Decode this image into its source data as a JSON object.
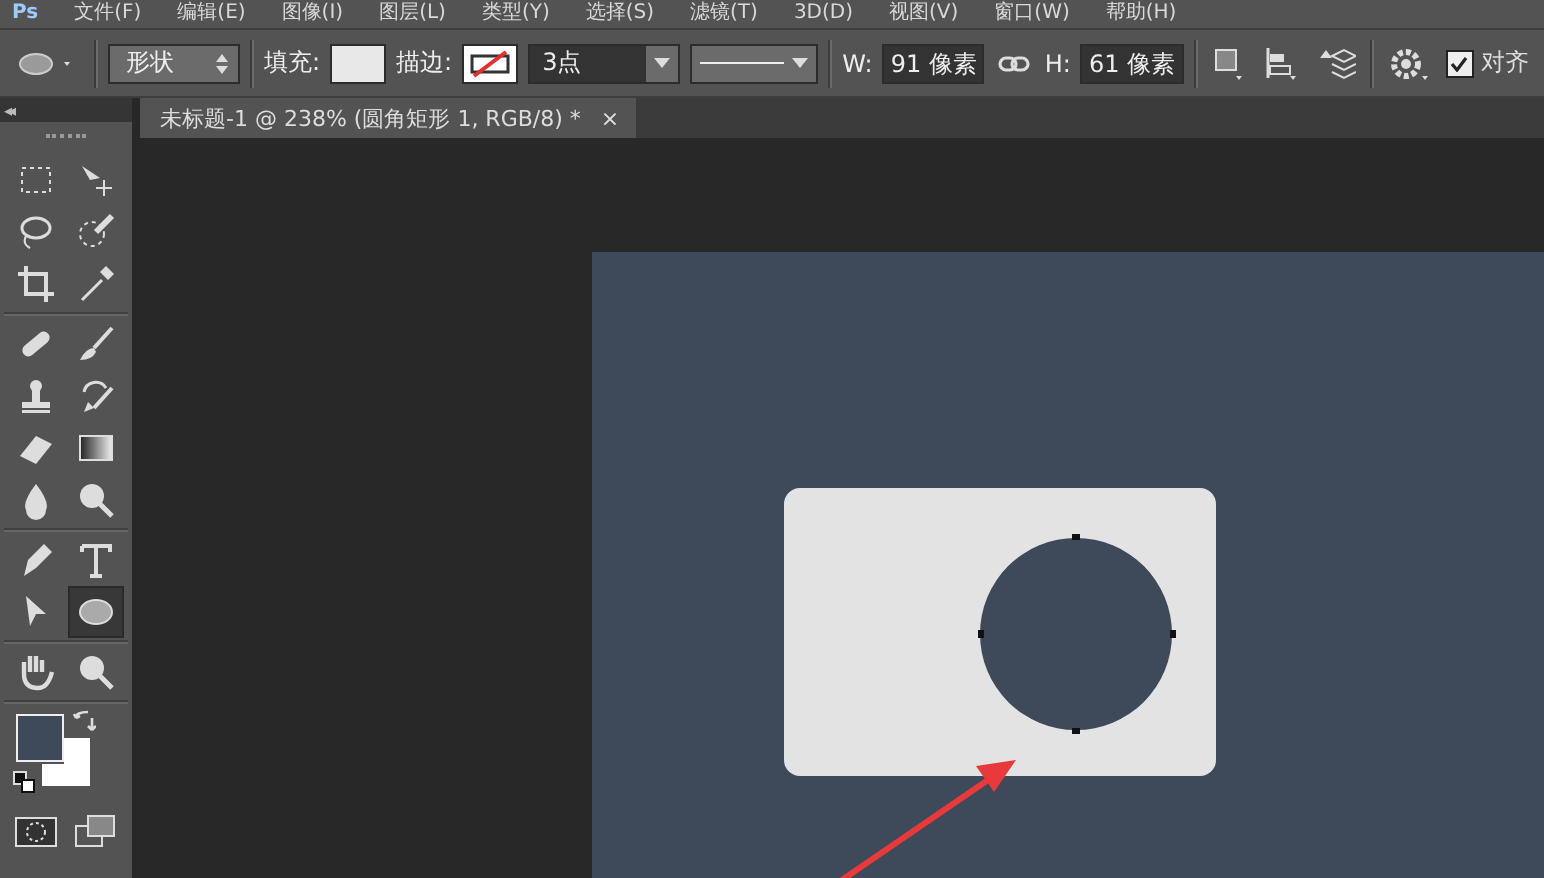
{
  "menu": [
    "Ps",
    "文件(F)",
    "编辑(E)",
    "图像(I)",
    "图层(L)",
    "类型(Y)",
    "选择(S)",
    "滤镜(T)",
    "3D(D)",
    "视图(V)",
    "窗口(W)",
    "帮助(H)"
  ],
  "options_bar": {
    "shape_mode": "形状",
    "fill_label": "填充:",
    "stroke_label": "描边:",
    "stroke_width": "3点",
    "width_label": "W:",
    "width_value": "91 像素",
    "height_label": "H:",
    "height_value": "61 像素",
    "align_edges": {
      "label": "对齐",
      "checked": true
    }
  },
  "tools": {
    "collapse": "◂◂",
    "groups": [
      [
        {
          "selected": false
        },
        {
          "selected": false
        },
        {
          "selected": false
        },
        {
          "selected": false
        },
        {
          "selected": false
        },
        {
          "selected": false
        }
      ],
      [
        {
          "selected": false
        },
        {
          "selected": false
        },
        {
          "selected": false
        },
        {
          "selected": false
        },
        {
          "selected": false
        },
        {
          "selected": false
        },
        {
          "selected": false
        },
        {
          "selected": false
        }
      ],
      [
        {
          "selected": false
        },
        {
          "selected": false
        },
        {
          "selected": false
        },
        {
          "selected": true
        }
      ],
      [
        {
          "selected": false
        },
        {
          "selected": false
        }
      ]
    ]
  },
  "tab": {
    "title": "未标题-1 @ 238% (圆角矩形 1, RGB/8) *",
    "close": "×"
  }
}
